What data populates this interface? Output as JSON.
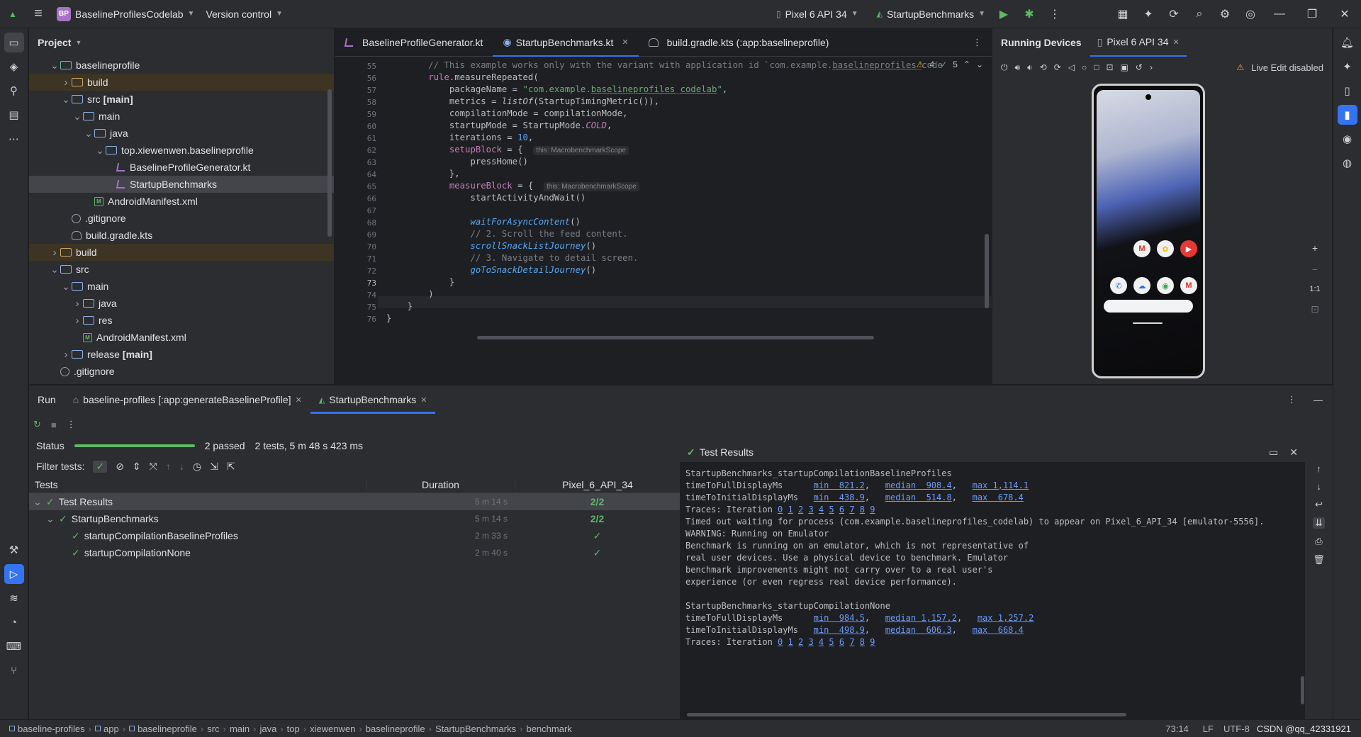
{
  "titlebar": {
    "project_badge": "BP",
    "project_name": "BaselineProfilesCodelab",
    "vcs": "Version control",
    "device": "Pixel 6 API 34",
    "run_config": "StartupBenchmarks"
  },
  "project_panel": {
    "title": "Project",
    "tree": [
      {
        "indent": 2,
        "chev": "v",
        "icon": "folder-src",
        "label": "baselineprofile",
        "style": "bold"
      },
      {
        "indent": 3,
        "chev": ">",
        "icon": "folder-build",
        "label": "build",
        "hl": true
      },
      {
        "indent": 3,
        "chev": "v",
        "icon": "folder",
        "label": "src",
        "suffix": "[main]"
      },
      {
        "indent": 4,
        "chev": "v",
        "icon": "folder",
        "label": "main"
      },
      {
        "indent": 5,
        "chev": "v",
        "icon": "folder",
        "label": "java"
      },
      {
        "indent": 6,
        "chev": "v",
        "icon": "folder",
        "label": "top.xiewenwen.baselineprofile"
      },
      {
        "indent": 7,
        "chev": "",
        "icon": "kt",
        "label": "BaselineProfileGenerator.kt"
      },
      {
        "indent": 7,
        "chev": "",
        "icon": "kt",
        "label": "StartupBenchmarks",
        "sel": true
      },
      {
        "indent": 5,
        "chev": "",
        "icon": "xml",
        "label": "AndroidManifest.xml"
      },
      {
        "indent": 3,
        "chev": "",
        "icon": "ignore",
        "label": ".gitignore"
      },
      {
        "indent": 3,
        "chev": "",
        "icon": "gradle",
        "label": "build.gradle.kts"
      },
      {
        "indent": 2,
        "chev": ">",
        "icon": "folder-build",
        "label": "build",
        "hl": true
      },
      {
        "indent": 2,
        "chev": "v",
        "icon": "folder",
        "label": "src"
      },
      {
        "indent": 3,
        "chev": "v",
        "icon": "folder",
        "label": "main",
        "style": "bold"
      },
      {
        "indent": 4,
        "chev": ">",
        "icon": "folder",
        "label": "java"
      },
      {
        "indent": 4,
        "chev": ">",
        "icon": "folder",
        "label": "res"
      },
      {
        "indent": 4,
        "chev": "",
        "icon": "xml",
        "label": "AndroidManifest.xml"
      },
      {
        "indent": 3,
        "chev": ">",
        "icon": "folder",
        "label": "release",
        "suffix": "[main]"
      },
      {
        "indent": 2,
        "chev": "",
        "icon": "ignore",
        "label": ".gitignore"
      }
    ]
  },
  "editor": {
    "tabs": [
      {
        "label": "BaselineProfileGenerator.kt",
        "active": false
      },
      {
        "label": "StartupBenchmarks.kt",
        "active": true
      },
      {
        "label": "build.gradle.kts (:app:baselineprofile)",
        "active": false
      }
    ],
    "inspections": {
      "warnings": "4",
      "ok": "5"
    },
    "line_numbers": [
      "55",
      "56",
      "57",
      "58",
      "59",
      "60",
      "61",
      "62",
      "63",
      "64",
      "65",
      "66",
      "67",
      "68",
      "69",
      "70",
      "71",
      "72",
      "73",
      "74",
      "75",
      "76"
    ]
  },
  "devices": {
    "title": "Running Devices",
    "device_tab": "Pixel 6 API 34",
    "live_edit": "Live Edit disabled",
    "zoom_label": "1:1",
    "apps_row1": [
      "M",
      "✿",
      "▶"
    ],
    "apps_row2": [
      "✆",
      "☁",
      "◉",
      "M"
    ]
  },
  "run_panel": {
    "tabs": [
      {
        "label": "Run",
        "active": false
      },
      {
        "label": "baseline-profiles [:app:generateBaselineProfile]",
        "active": false
      },
      {
        "label": "StartupBenchmarks",
        "active": true
      }
    ],
    "status_label": "Status",
    "progress": 1.0,
    "passed": "2 passed",
    "summary": "2 tests, 5 m 48 s 423 ms",
    "filter_label": "Filter tests:",
    "columns": [
      "Tests",
      "Duration",
      "Pixel_6_API_34"
    ],
    "rows": [
      {
        "indent": 0,
        "label": "Test Results",
        "duration": "5 m 14 s",
        "result": "2/2"
      },
      {
        "indent": 1,
        "label": "StartupBenchmarks",
        "duration": "5 m 14 s",
        "result": "2/2"
      },
      {
        "indent": 2,
        "label": "startupCompilationBaselineProfiles",
        "duration": "2 m 33 s",
        "result": "✓"
      },
      {
        "indent": 2,
        "label": "startupCompilationNone",
        "duration": "2 m 40 s",
        "result": "✓"
      }
    ],
    "console_title": "Test Results"
  },
  "statusbar": {
    "crumbs": [
      "baseline-profiles",
      "app",
      "baselineprofile",
      "src",
      "main",
      "java",
      "top",
      "xiewenwen",
      "baselineprofile",
      "StartupBenchmarks",
      "benchmark"
    ],
    "position": "73:14",
    "line_sep": "LF",
    "encoding": "UTF-8",
    "watermark": "CSDN @qq_42331921"
  },
  "colors": {
    "accent": "#3574f0",
    "pass": "#5fb865",
    "bg": "#1e1f22",
    "panel": "#2b2d30"
  }
}
